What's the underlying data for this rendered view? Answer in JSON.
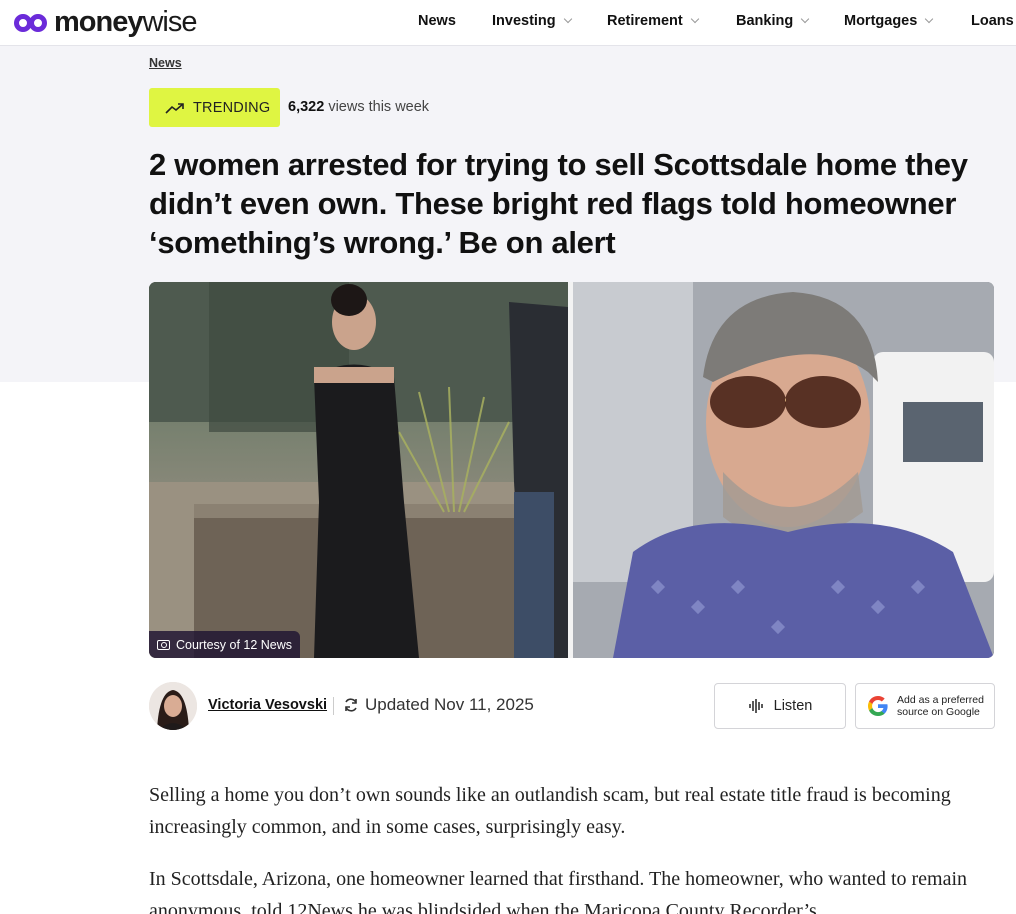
{
  "brand": {
    "name_bold": "money",
    "name_light": "wise"
  },
  "nav": [
    {
      "label": "News",
      "has_menu": false
    },
    {
      "label": "Investing",
      "has_menu": true
    },
    {
      "label": "Retirement",
      "has_menu": true
    },
    {
      "label": "Banking",
      "has_menu": true
    },
    {
      "label": "Mortgages",
      "has_menu": true
    },
    {
      "label": "Loans",
      "has_menu": false
    }
  ],
  "breadcrumb": "News",
  "trending": {
    "label": "TRENDING",
    "views_count": "6,322",
    "views_suffix": "views this week"
  },
  "headline": "2 women arrested for trying to sell Scottsdale home they didn’t even own. These bright red flags told homeowner ‘something’s wrong.’ Be on alert",
  "photo": {
    "caption": "Courtesy of 12 News"
  },
  "byline": {
    "author": "Victoria Vesovski",
    "updated": "Updated Nov 11, 2025",
    "listen_label": "Listen",
    "google_line1": "Add as a preferred",
    "google_line2": "source on Google"
  },
  "body": [
    "Selling a home you don’t own sounds like an outlandish scam, but real estate title fraud is becoming increasingly common, and in some cases, surprisingly easy.",
    "In Scottsdale, Arizona, one homeowner learned that firsthand. The homeowner, who wanted to remain anonymous, told 12News he was blindsided when the Maricopa County Recorder’s"
  ],
  "colors": {
    "accent": "#6b2bd9",
    "trending_bg": "#dff542",
    "band_bg": "#f4f4f8"
  }
}
